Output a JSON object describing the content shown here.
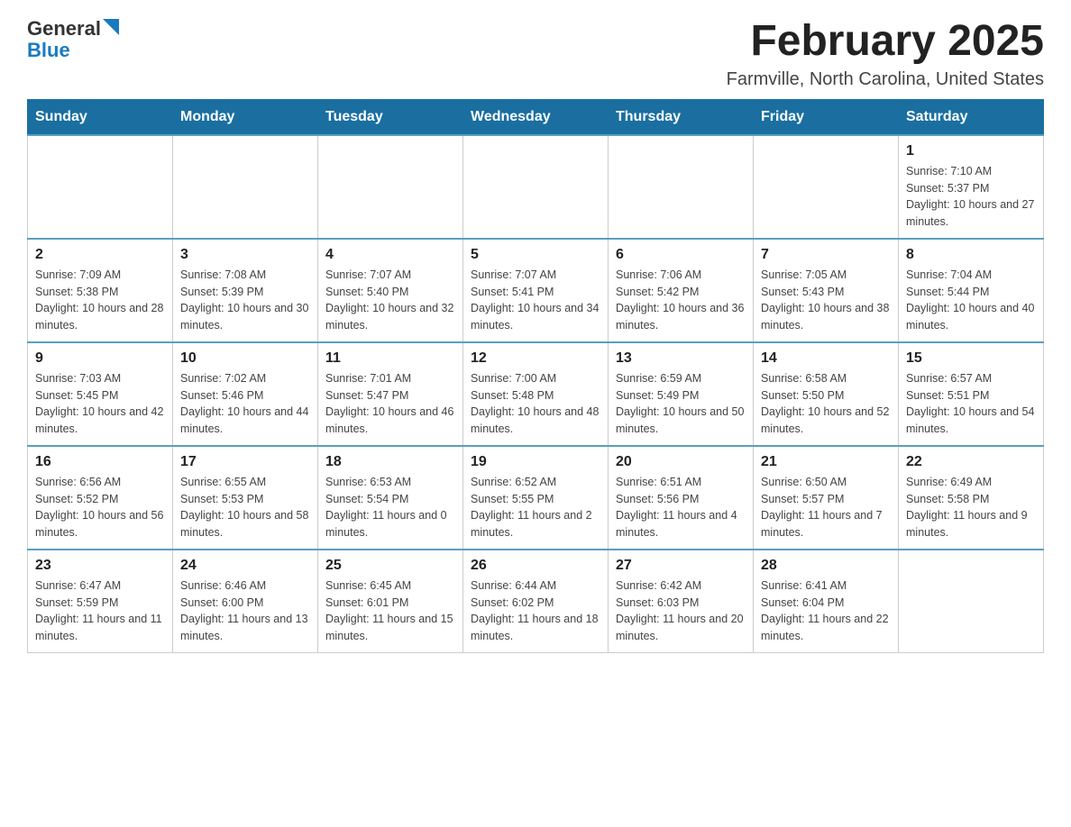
{
  "header": {
    "logo_general": "General",
    "logo_blue": "Blue",
    "month_title": "February 2025",
    "location": "Farmville, North Carolina, United States"
  },
  "weekdays": [
    "Sunday",
    "Monday",
    "Tuesday",
    "Wednesday",
    "Thursday",
    "Friday",
    "Saturday"
  ],
  "weeks": [
    {
      "days": [
        {
          "number": "",
          "info": "",
          "empty": true
        },
        {
          "number": "",
          "info": "",
          "empty": true
        },
        {
          "number": "",
          "info": "",
          "empty": true
        },
        {
          "number": "",
          "info": "",
          "empty": true
        },
        {
          "number": "",
          "info": "",
          "empty": true
        },
        {
          "number": "",
          "info": "",
          "empty": true
        },
        {
          "number": "1",
          "info": "Sunrise: 7:10 AM\nSunset: 5:37 PM\nDaylight: 10 hours and 27 minutes.",
          "empty": false
        }
      ]
    },
    {
      "days": [
        {
          "number": "2",
          "info": "Sunrise: 7:09 AM\nSunset: 5:38 PM\nDaylight: 10 hours and 28 minutes.",
          "empty": false
        },
        {
          "number": "3",
          "info": "Sunrise: 7:08 AM\nSunset: 5:39 PM\nDaylight: 10 hours and 30 minutes.",
          "empty": false
        },
        {
          "number": "4",
          "info": "Sunrise: 7:07 AM\nSunset: 5:40 PM\nDaylight: 10 hours and 32 minutes.",
          "empty": false
        },
        {
          "number": "5",
          "info": "Sunrise: 7:07 AM\nSunset: 5:41 PM\nDaylight: 10 hours and 34 minutes.",
          "empty": false
        },
        {
          "number": "6",
          "info": "Sunrise: 7:06 AM\nSunset: 5:42 PM\nDaylight: 10 hours and 36 minutes.",
          "empty": false
        },
        {
          "number": "7",
          "info": "Sunrise: 7:05 AM\nSunset: 5:43 PM\nDaylight: 10 hours and 38 minutes.",
          "empty": false
        },
        {
          "number": "8",
          "info": "Sunrise: 7:04 AM\nSunset: 5:44 PM\nDaylight: 10 hours and 40 minutes.",
          "empty": false
        }
      ]
    },
    {
      "days": [
        {
          "number": "9",
          "info": "Sunrise: 7:03 AM\nSunset: 5:45 PM\nDaylight: 10 hours and 42 minutes.",
          "empty": false
        },
        {
          "number": "10",
          "info": "Sunrise: 7:02 AM\nSunset: 5:46 PM\nDaylight: 10 hours and 44 minutes.",
          "empty": false
        },
        {
          "number": "11",
          "info": "Sunrise: 7:01 AM\nSunset: 5:47 PM\nDaylight: 10 hours and 46 minutes.",
          "empty": false
        },
        {
          "number": "12",
          "info": "Sunrise: 7:00 AM\nSunset: 5:48 PM\nDaylight: 10 hours and 48 minutes.",
          "empty": false
        },
        {
          "number": "13",
          "info": "Sunrise: 6:59 AM\nSunset: 5:49 PM\nDaylight: 10 hours and 50 minutes.",
          "empty": false
        },
        {
          "number": "14",
          "info": "Sunrise: 6:58 AM\nSunset: 5:50 PM\nDaylight: 10 hours and 52 minutes.",
          "empty": false
        },
        {
          "number": "15",
          "info": "Sunrise: 6:57 AM\nSunset: 5:51 PM\nDaylight: 10 hours and 54 minutes.",
          "empty": false
        }
      ]
    },
    {
      "days": [
        {
          "number": "16",
          "info": "Sunrise: 6:56 AM\nSunset: 5:52 PM\nDaylight: 10 hours and 56 minutes.",
          "empty": false
        },
        {
          "number": "17",
          "info": "Sunrise: 6:55 AM\nSunset: 5:53 PM\nDaylight: 10 hours and 58 minutes.",
          "empty": false
        },
        {
          "number": "18",
          "info": "Sunrise: 6:53 AM\nSunset: 5:54 PM\nDaylight: 11 hours and 0 minutes.",
          "empty": false
        },
        {
          "number": "19",
          "info": "Sunrise: 6:52 AM\nSunset: 5:55 PM\nDaylight: 11 hours and 2 minutes.",
          "empty": false
        },
        {
          "number": "20",
          "info": "Sunrise: 6:51 AM\nSunset: 5:56 PM\nDaylight: 11 hours and 4 minutes.",
          "empty": false
        },
        {
          "number": "21",
          "info": "Sunrise: 6:50 AM\nSunset: 5:57 PM\nDaylight: 11 hours and 7 minutes.",
          "empty": false
        },
        {
          "number": "22",
          "info": "Sunrise: 6:49 AM\nSunset: 5:58 PM\nDaylight: 11 hours and 9 minutes.",
          "empty": false
        }
      ]
    },
    {
      "days": [
        {
          "number": "23",
          "info": "Sunrise: 6:47 AM\nSunset: 5:59 PM\nDaylight: 11 hours and 11 minutes.",
          "empty": false
        },
        {
          "number": "24",
          "info": "Sunrise: 6:46 AM\nSunset: 6:00 PM\nDaylight: 11 hours and 13 minutes.",
          "empty": false
        },
        {
          "number": "25",
          "info": "Sunrise: 6:45 AM\nSunset: 6:01 PM\nDaylight: 11 hours and 15 minutes.",
          "empty": false
        },
        {
          "number": "26",
          "info": "Sunrise: 6:44 AM\nSunset: 6:02 PM\nDaylight: 11 hours and 18 minutes.",
          "empty": false
        },
        {
          "number": "27",
          "info": "Sunrise: 6:42 AM\nSunset: 6:03 PM\nDaylight: 11 hours and 20 minutes.",
          "empty": false
        },
        {
          "number": "28",
          "info": "Sunrise: 6:41 AM\nSunset: 6:04 PM\nDaylight: 11 hours and 22 minutes.",
          "empty": false
        },
        {
          "number": "",
          "info": "",
          "empty": true
        }
      ]
    }
  ]
}
